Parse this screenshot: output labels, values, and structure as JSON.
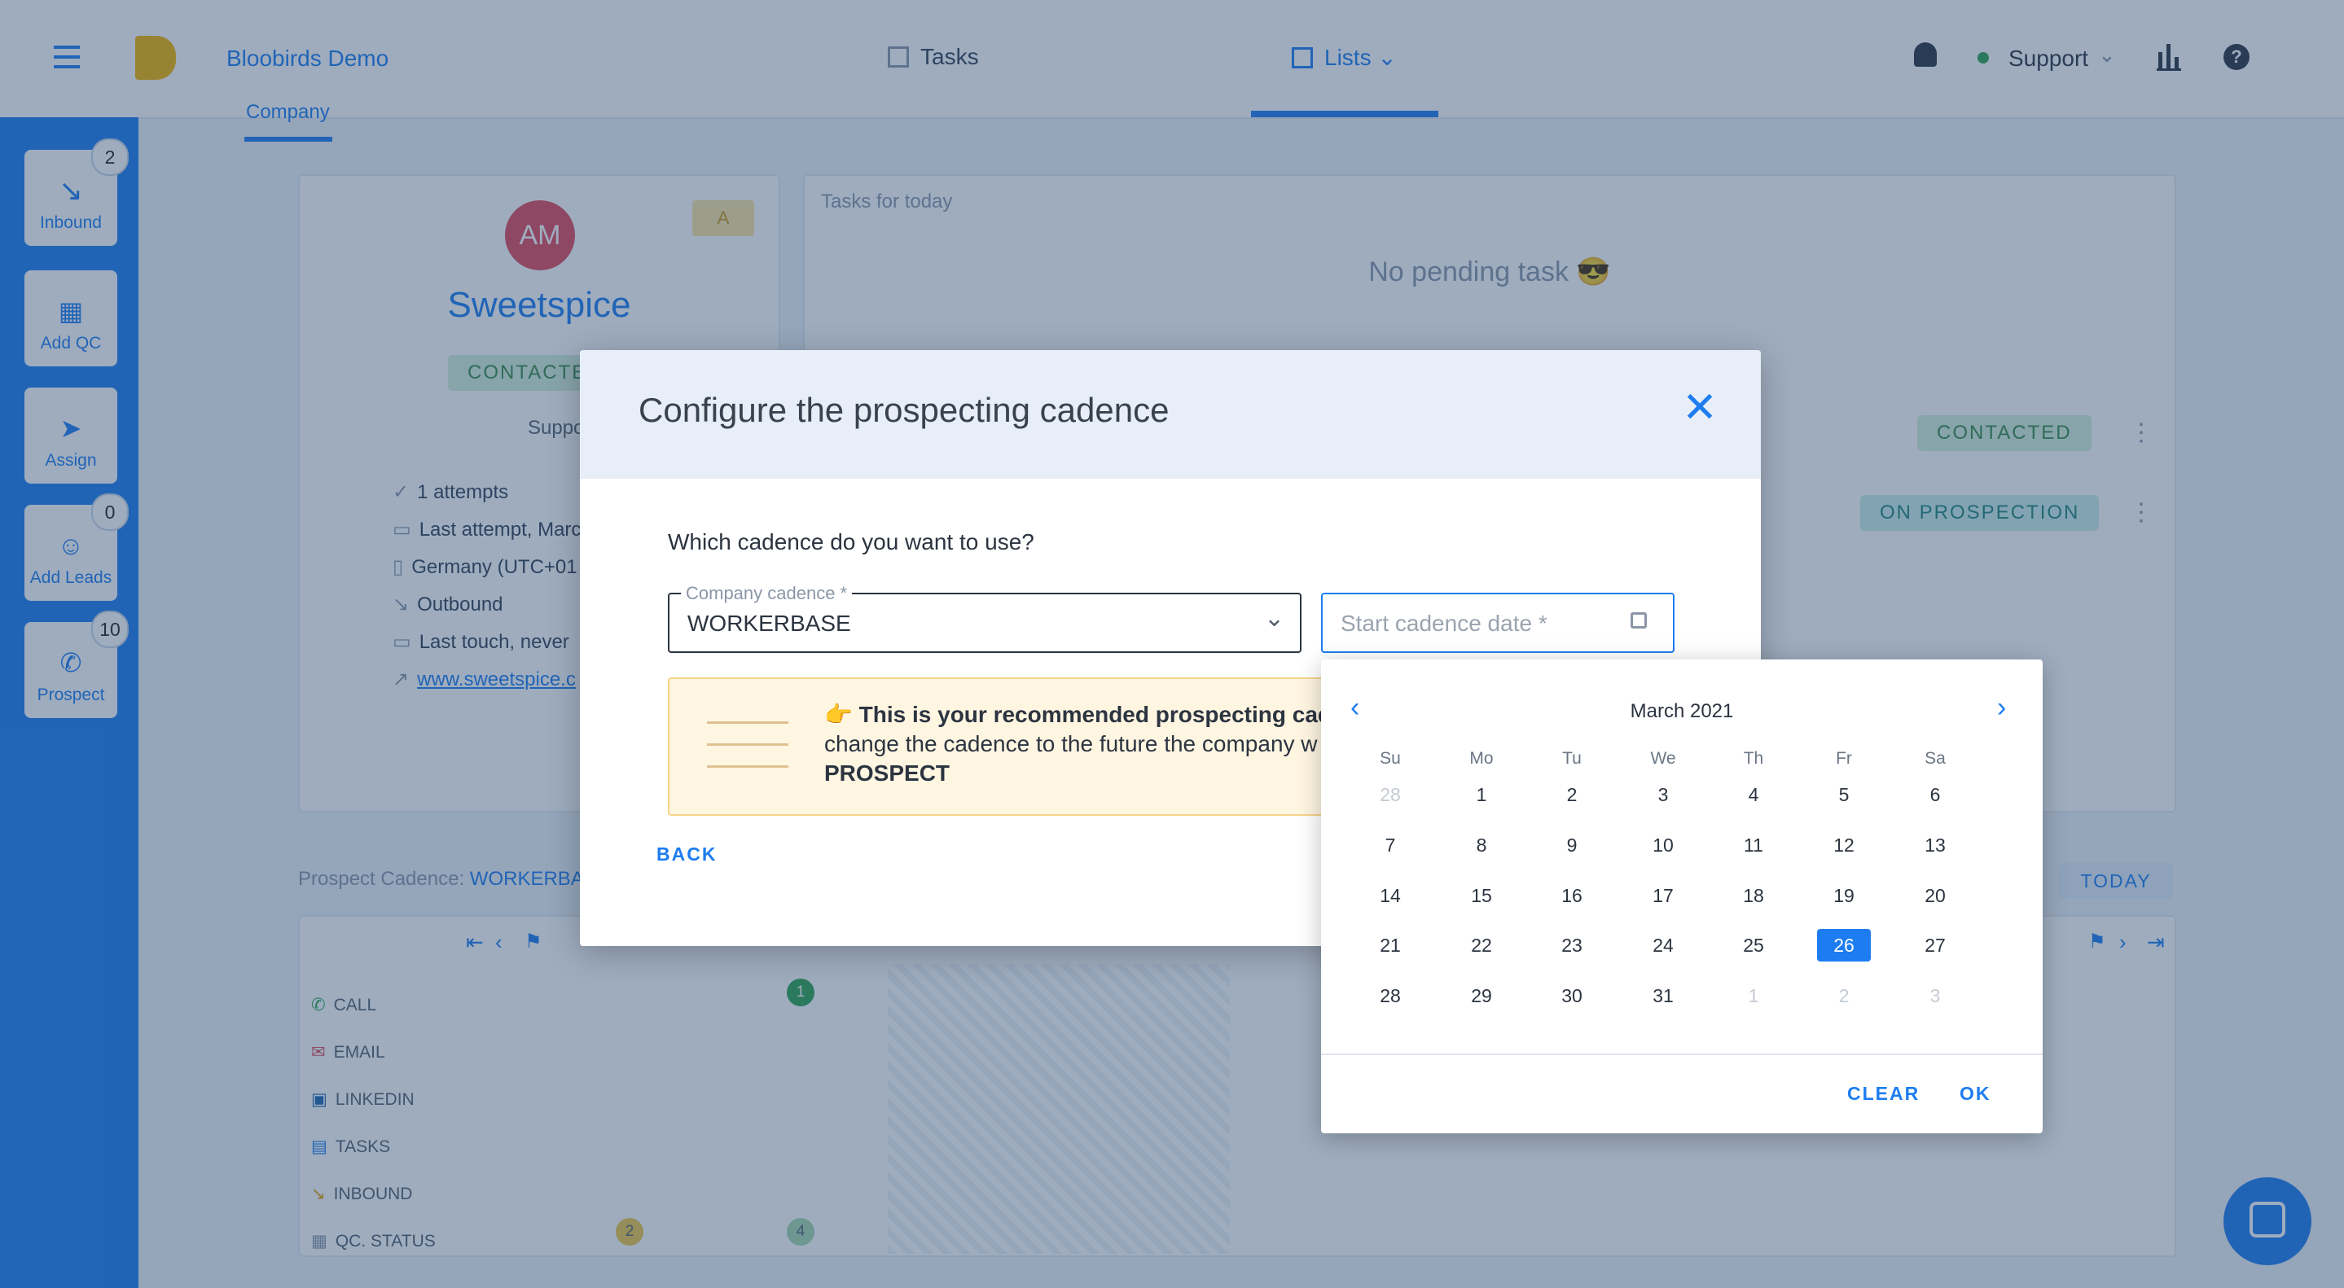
{
  "topbar": {
    "brand": "Bloobirds Demo",
    "nav_tasks": "Tasks",
    "nav_lists": "Lists",
    "user": "Support",
    "tab_company": "Company"
  },
  "sidebar": [
    {
      "label": "Inbound",
      "badge": "2",
      "icon": "arrow-down-right-icon"
    },
    {
      "label": "Add QC",
      "badge": "",
      "icon": "building-icon"
    },
    {
      "label": "Assign",
      "badge": "",
      "icon": "send-icon"
    },
    {
      "label": "Add Leads",
      "badge": "0",
      "icon": "add-user-icon"
    },
    {
      "label": "Prospect",
      "badge": "10",
      "icon": "phone-icon"
    }
  ],
  "company": {
    "avatar": "AM",
    "badge": "A",
    "name": "Sweetspice",
    "status": "CONTACTED",
    "owner": "Support",
    "details": [
      "1 attempts",
      "Last attempt, March",
      "Germany (UTC+01",
      "Outbound",
      "Last touch, never",
      "www.sweetspice.c"
    ]
  },
  "tasks": {
    "header": "Tasks for today",
    "empty": "No pending task 😎",
    "pills": [
      "CONTACTED",
      "ON PROSPECTION"
    ]
  },
  "cadence_panel": {
    "label": "Prospect Cadence:",
    "value": "WORKERBASE",
    "today": "TODAY",
    "rows": [
      "CALL",
      "EMAIL",
      "LINKEDIN",
      "TASKS",
      "INBOUND",
      "QC. STATUS"
    ],
    "markers": [
      "1",
      "2",
      "4"
    ]
  },
  "modal": {
    "title": "Configure the prospecting cadence",
    "question": "Which cadence do you want to use?",
    "cadence_label": "Company cadence *",
    "cadence_value": "WORKERBASE",
    "date_placeholder": "Start cadence date *",
    "tip_bold": "This is your recommended prospecting cade",
    "tip_emoji": "👉",
    "tip_text": "change the cadence to the future the company w",
    "tip_bold2": "PROSPECT",
    "back": "BACK"
  },
  "calendar": {
    "month": "March 2021",
    "weekdays": [
      "Su",
      "Mo",
      "Tu",
      "We",
      "Th",
      "Fr",
      "Sa"
    ],
    "weeks": [
      [
        "28",
        "1",
        "2",
        "3",
        "4",
        "5",
        "6"
      ],
      [
        "7",
        "8",
        "9",
        "10",
        "11",
        "12",
        "13"
      ],
      [
        "14",
        "15",
        "16",
        "17",
        "18",
        "19",
        "20"
      ],
      [
        "21",
        "22",
        "23",
        "24",
        "25",
        "26",
        "27"
      ],
      [
        "28",
        "29",
        "30",
        "31",
        "1",
        "2",
        "3"
      ]
    ],
    "selected": "26",
    "clear": "CLEAR",
    "ok": "OK"
  },
  "colors": {
    "accent": "#1d7df0",
    "contacted": "#58b868",
    "prospection": "#35b3a0"
  }
}
